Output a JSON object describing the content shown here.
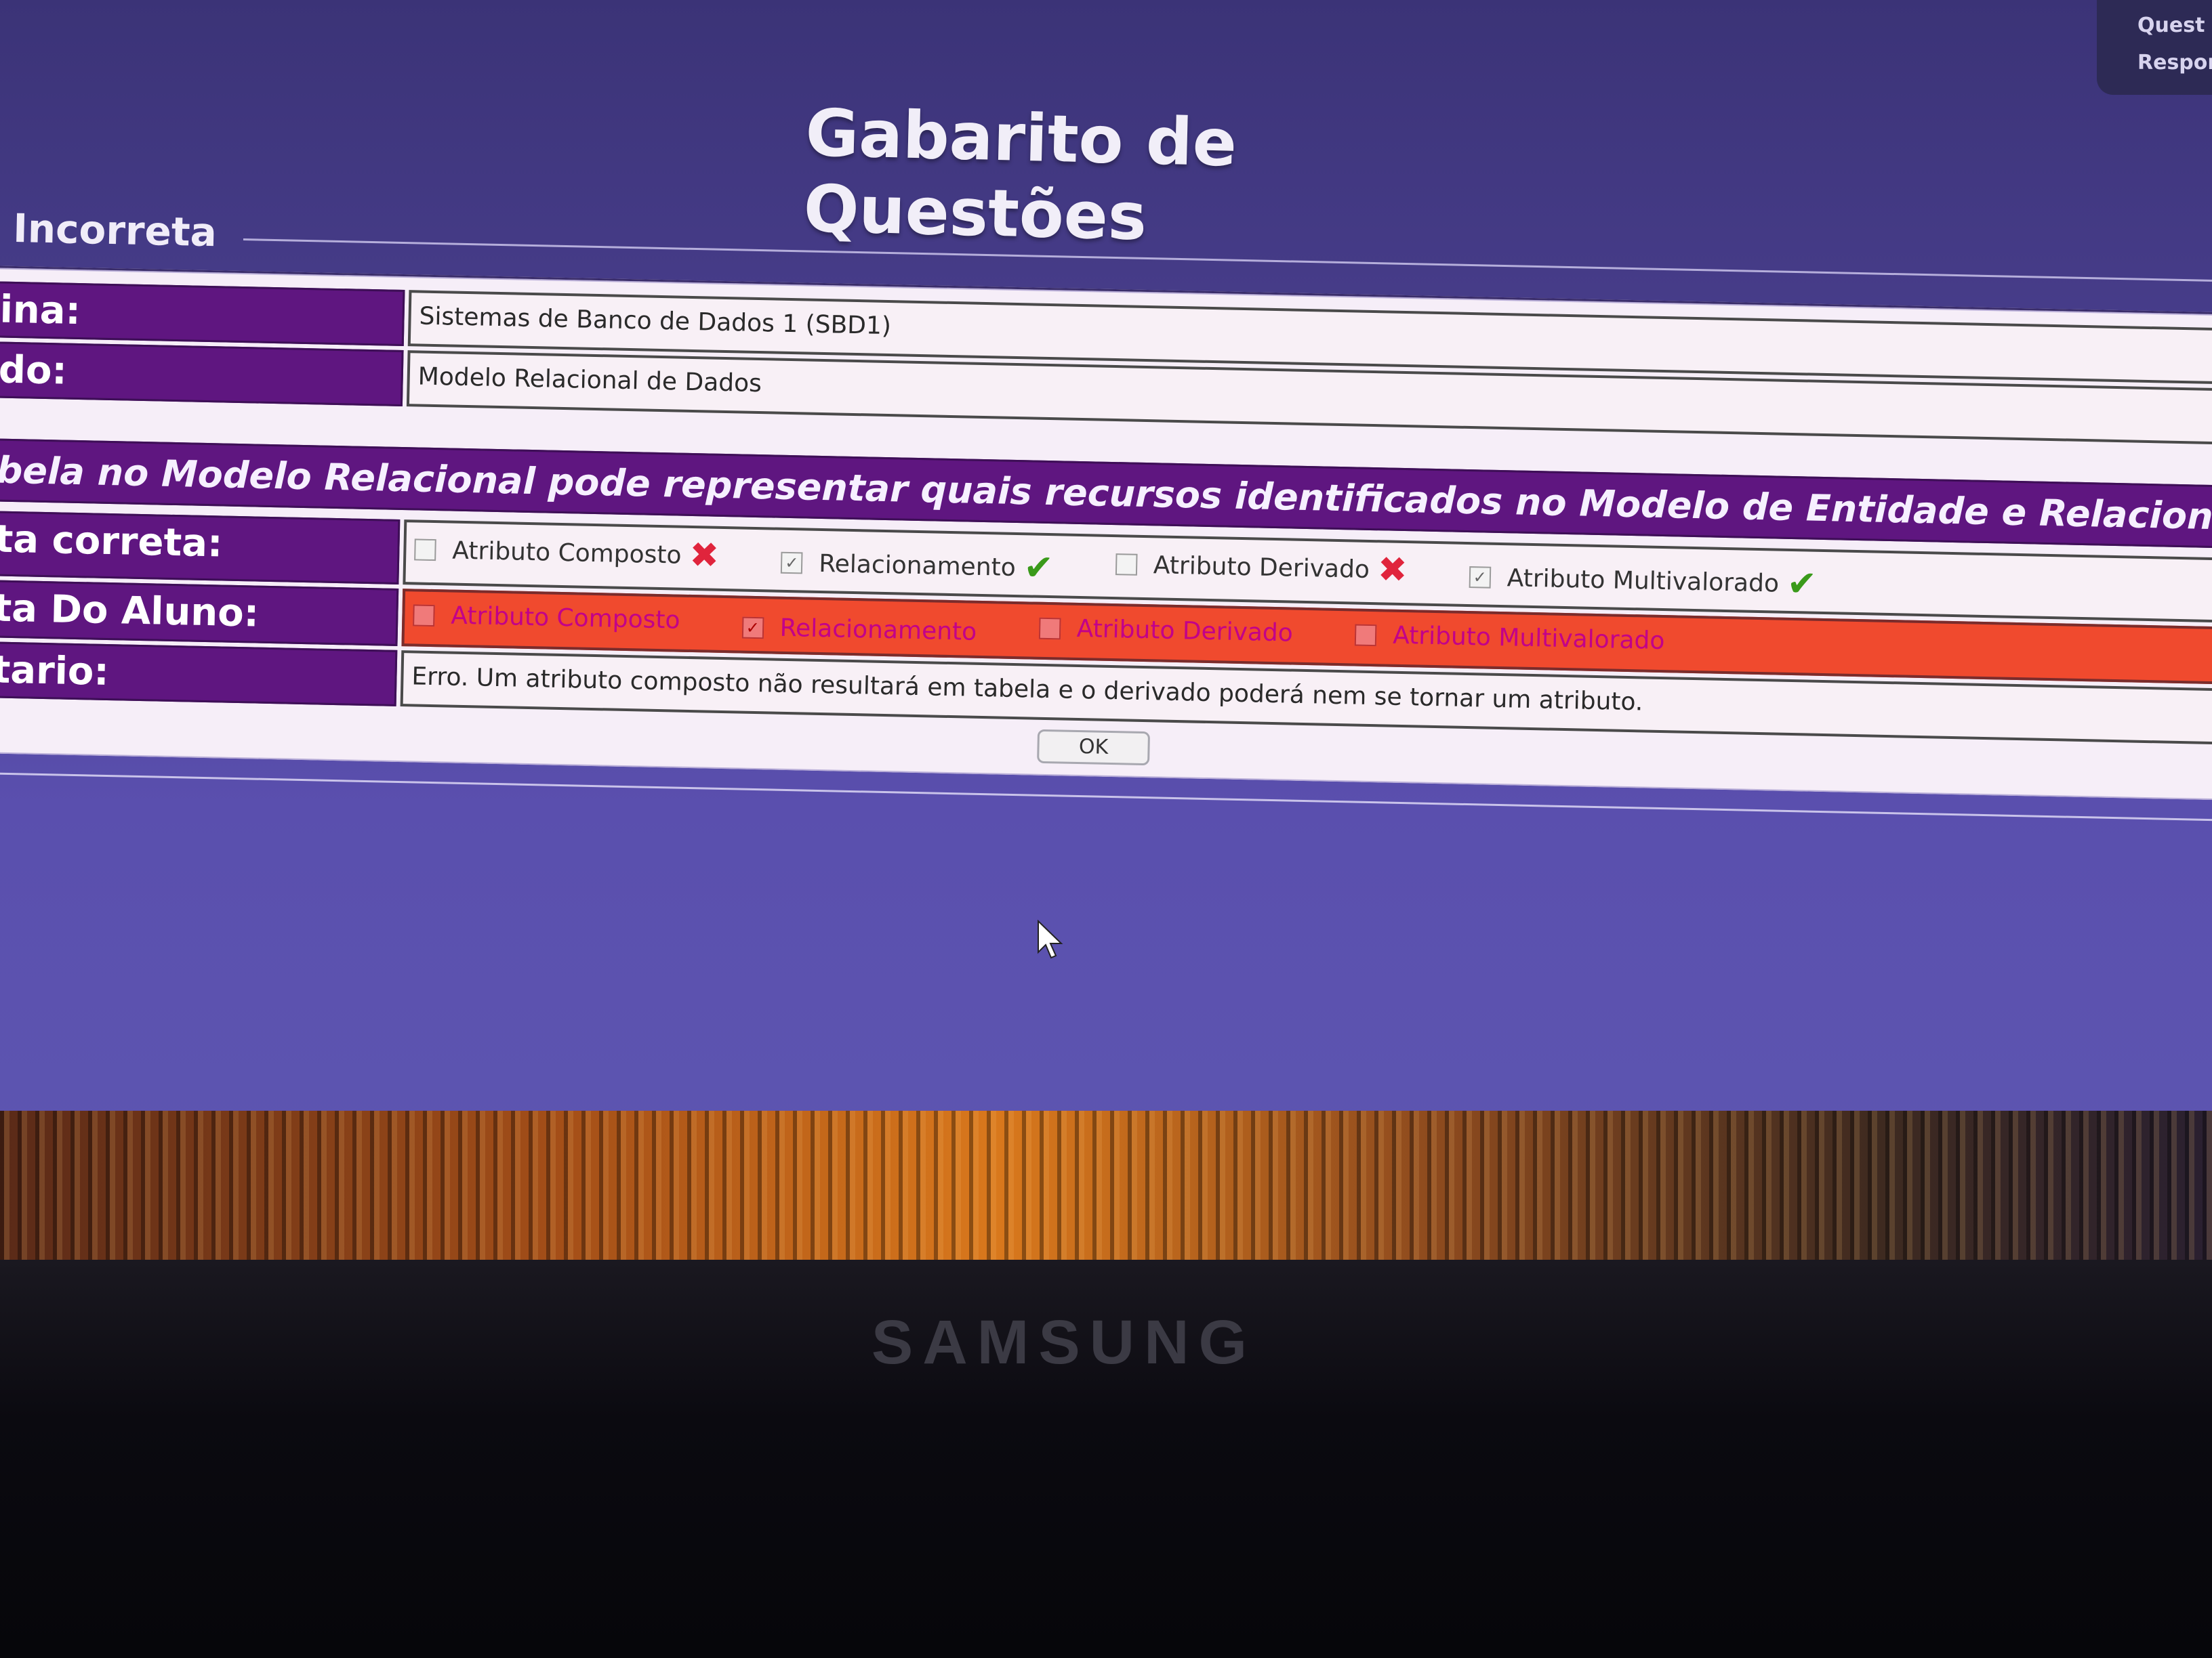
{
  "tabs": [
    "Quest",
    "Respon"
  ],
  "page_title": "Gabarito de Questões",
  "fieldset_legend": "o Incorreta",
  "disciplina": {
    "label": "ina:",
    "value": "Sistemas de Banco de Dados 1 (SBD1)"
  },
  "conteudo": {
    "label": "do:",
    "value": "Modelo Relacional de Dados"
  },
  "question": "bela no Modelo Relacional pode representar quais recursos identificados no Modelo de Entidade e Relacionamento (ME-R).",
  "correct_answer": {
    "label": "ta correta:",
    "options": [
      {
        "text": "Atributo Composto",
        "checked": false,
        "mark": "✖",
        "mark_icon": "x-mark-icon"
      },
      {
        "text": "Relacionamento",
        "checked": true,
        "mark": "✔",
        "mark_icon": "check-mark-icon"
      },
      {
        "text": "Atributo Derivado",
        "checked": false,
        "mark": "✖",
        "mark_icon": "x-mark-icon"
      },
      {
        "text": "Atributo Multivalorado",
        "checked": true,
        "mark": "✔",
        "mark_icon": "check-mark-icon"
      }
    ]
  },
  "student_answer": {
    "label": "ta Do Aluno:",
    "options": [
      {
        "text": "Atributo Composto",
        "checked": false
      },
      {
        "text": "Relacionamento",
        "checked": true
      },
      {
        "text": "Atributo Derivado",
        "checked": false
      },
      {
        "text": "Atributo Multivalorado",
        "checked": false
      }
    ]
  },
  "comment": {
    "label": "tario:",
    "value": "Erro. Um atributo composto não resultará em tabela e o derivado poderá nem se tornar um atributo."
  },
  "ok_label": "OK",
  "monitor_brand": "SAMSUNG",
  "colors": {
    "label_bg": "#5f1680",
    "wrong_bg": "#f04a2e",
    "screen_bg": "#4a3f8f"
  }
}
